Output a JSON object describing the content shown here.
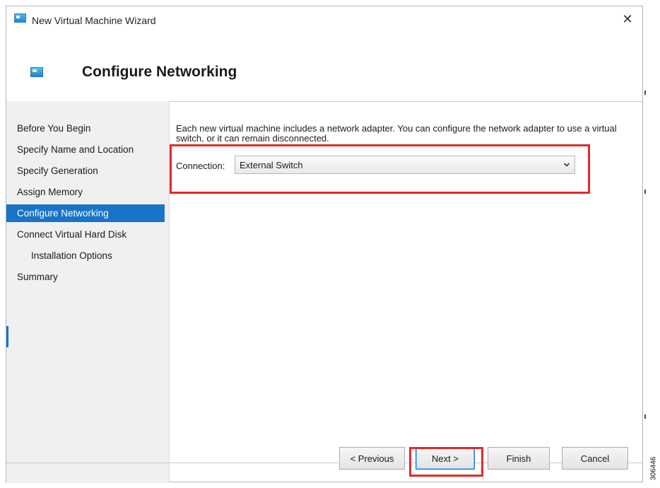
{
  "window": {
    "title": "New Virtual Machine Wizard",
    "close_glyph": "✕",
    "icon": "virtual-machine-icon"
  },
  "header": {
    "title": "Configure Networking",
    "icon": "network-adapter-icon"
  },
  "sidebar": {
    "steps": [
      {
        "label": "Before You Begin"
      },
      {
        "label": "Specify Name and Location"
      },
      {
        "label": "Specify Generation"
      },
      {
        "label": "Assign Memory"
      },
      {
        "label": "Configure Networking",
        "active": true
      },
      {
        "label": "Connect Virtual Hard Disk"
      },
      {
        "label": "Installation Options",
        "sub": true
      },
      {
        "label": "Summary"
      }
    ]
  },
  "content": {
    "description": "Each new virtual machine includes a network adapter. You can configure the network adapter to use a virtual switch, or it can remain disconnected.",
    "connection_label": "Connection:",
    "connection_value": "External Switch"
  },
  "buttons": {
    "previous": "< Previous",
    "next": "Next >",
    "finish": "Finish",
    "cancel": "Cancel"
  },
  "figure_id": "306446",
  "colors": {
    "accent": "#1874c6",
    "highlight": "#e42a2a",
    "sidebar_bg": "#f0f0f0"
  }
}
